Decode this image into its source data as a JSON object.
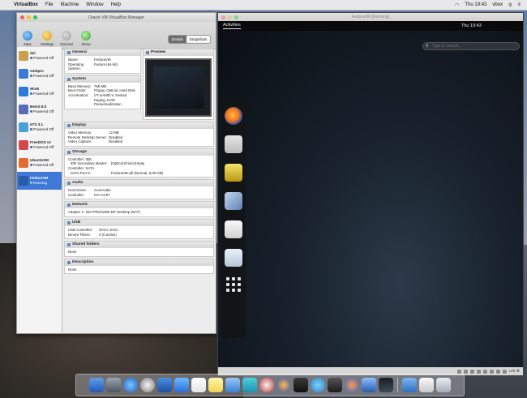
{
  "menubar": {
    "app_name": "VirtualBox",
    "menus": [
      "File",
      "Machine",
      "Window",
      "Help"
    ],
    "clock": "Thu 19:43",
    "user": "vbox"
  },
  "manager": {
    "title": "Oracle VM VirtualBox Manager",
    "toolbar": {
      "new": "New",
      "settings": "Settings",
      "discard": "Discard",
      "show": "Show"
    },
    "segmented": {
      "details": "Details",
      "snapshots": "Snapshots"
    },
    "vms": [
      {
        "name": "dsl",
        "state": "Powered Off",
        "color": "#c8a24a"
      },
      {
        "name": "smbpro",
        "state": "Powered Off",
        "color": "#3b7bd6"
      },
      {
        "name": "Win8",
        "state": "Powered Off",
        "color": "#2a7ad6"
      },
      {
        "name": "BeOS 5.0",
        "state": "Powered Off",
        "color": "#5a6ab6"
      },
      {
        "name": "eTS 3.1",
        "state": "Powered Off",
        "color": "#4aa0d8"
      },
      {
        "name": "FreeDOS v1",
        "state": "Powered Off",
        "color": "#d04a4a"
      },
      {
        "name": "UbuntuVM",
        "state": "Powered Off",
        "color": "#e36b2f"
      },
      {
        "name": "FedoraVM",
        "state": "Running",
        "color": "#2a5aa8"
      }
    ],
    "sections": {
      "general": {
        "title": "General",
        "name_label": "Name:",
        "name": "FedoraVM",
        "os_label": "Operating System:",
        "os": "Fedora (64-bit)"
      },
      "preview": {
        "title": "Preview"
      },
      "system": {
        "title": "System",
        "mem_label": "Base Memory:",
        "mem": "768 MB",
        "boot_label": "Boot Order:",
        "boot": "Floppy, Optical, Hard Disk",
        "accel_label": "Acceleration:",
        "accel": "VT-x/AMD-V, Nested Paging, KVM Paravirtualization"
      },
      "display": {
        "title": "Display",
        "vmem_label": "Video Memory:",
        "vmem": "12 MB",
        "rds_label": "Remote Desktop Server:",
        "rds": "Disabled",
        "cap_label": "Video Capture:",
        "cap": "Disabled"
      },
      "storage": {
        "title": "Storage",
        "line1": "Controller: IDE",
        "line2_label": "IDE Secondary Master:",
        "line2": "[Optical Drive] Empty",
        "line3": "Controller: SATA",
        "line4_label": "SATA Port 0:",
        "line4": "FedoraVM.vdi (Normal, 8,00 GB)"
      },
      "audio": {
        "title": "Audio",
        "host_label": "Host Driver:",
        "host": "CoreAudio",
        "ctrl_label": "Controller:",
        "ctrl": "ICH AC97"
      },
      "network": {
        "title": "Network",
        "line": "Adapter 1:  Intel PRO/1000 MT Desktop (NAT)"
      },
      "usb": {
        "title": "USB",
        "ctrl_label": "USB Controller:",
        "ctrl": "OHCI, EHCI",
        "filters_label": "Device Filters:",
        "filters": "0 (0 active)"
      },
      "shared": {
        "title": "Shared folders",
        "value": "None"
      },
      "description": {
        "title": "Description",
        "value": "None"
      }
    }
  },
  "fedora": {
    "title": "FedoraVM [Running]",
    "activities": "Activities",
    "clock": "Thu 19:43",
    "search_placeholder": "Type to search…",
    "status_right": "Left ⌘"
  }
}
